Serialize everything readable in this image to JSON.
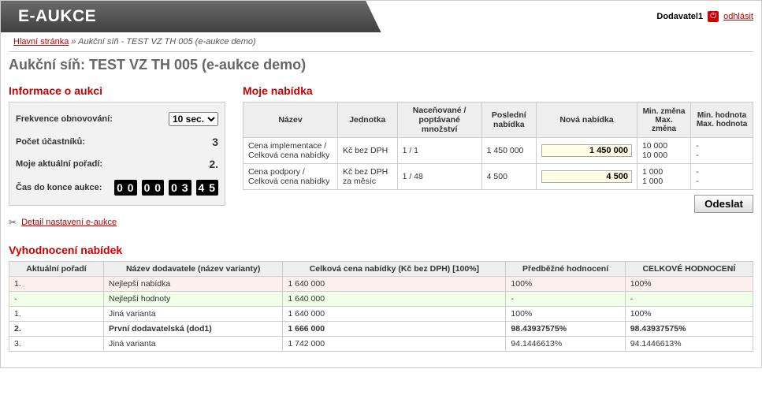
{
  "header": {
    "app_name": "E-AUKCE",
    "user": "Dodavatel1",
    "logout_label": "odhlásit"
  },
  "breadcrumb": {
    "home": "Hlavní stránka",
    "separator": " » ",
    "current": "Aukční síň - TEST VZ TH 005 (e-aukce demo)"
  },
  "page_title": "Aukční síň: TEST VZ TH 005 (e-aukce demo)",
  "info": {
    "title": "Informace o aukci",
    "refresh_label": "Frekvence obnovování:",
    "refresh_value": "10 sec.",
    "participants_label": "Počet účastníků:",
    "participants_value": "3",
    "rank_label": "Moje aktuální pořadí:",
    "rank_value": "2.",
    "countdown_label": "Čas do konce aukce:",
    "countdown_digits": [
      "0 0",
      "0 0",
      "0 3",
      "4 5"
    ],
    "settings_link": "Detail nastavení e-aukce"
  },
  "bids": {
    "title": "Moje nabídka",
    "headers": {
      "name": "Název",
      "unit": "Jednotka",
      "qty": "Naceňované / poptávané množství",
      "last": "Poslední nabídka",
      "new": "Nová nabídka",
      "minchange": "Min. změna Max. změna",
      "minval": "Min. hodnota Max. hodnota"
    },
    "rows": [
      {
        "name": "Cena implementace / Celková cena nabídky",
        "unit": "Kč bez DPH",
        "qty": "1 / 1",
        "last": "1 450 000",
        "new": "1 450 000",
        "minchange1": "10 000",
        "minchange2": "10 000",
        "minval": "-"
      },
      {
        "name": "Cena podpory / Celková cena nabídky",
        "unit": "Kč bez DPH za měsíc",
        "qty": "1 / 48",
        "last": "4 500",
        "new": "4 500",
        "minchange1": "1 000",
        "minchange2": "1 000",
        "minval": "-"
      }
    ],
    "submit": "Odeslat"
  },
  "eval": {
    "title": "Vyhodnocení nabídek",
    "headers": {
      "rank": "Aktuální pořadí",
      "supplier": "Název dodavatele (název varianty)",
      "total": "Celková cena nabídky (Kč bez DPH) [100%]",
      "pre": "Předběžné hodnocení",
      "total_score": "CELKOVÉ HODNOCENÍ"
    },
    "rows": [
      {
        "rank": "1.",
        "supplier": "Nejlepší nabídka",
        "total": "1 640 000",
        "pre": "100%",
        "score": "100%",
        "cls": "best"
      },
      {
        "rank": "-",
        "supplier": "Nejlepší hodnoty",
        "total": "1 640 000",
        "pre": "-",
        "score": "-",
        "cls": "best-val"
      },
      {
        "rank": "1.",
        "supplier": "Jiná varianta",
        "total": "1 640 000",
        "pre": "100%",
        "score": "100%",
        "cls": ""
      },
      {
        "rank": "2.",
        "supplier": "První dodavatelská (dod1)",
        "total": "1 666 000",
        "pre": "98.43937575%",
        "score": "98.43937575%",
        "cls": "me"
      },
      {
        "rank": "3.",
        "supplier": "Jiná varianta",
        "total": "1 742 000",
        "pre": "94.1446613%",
        "score": "94.1446613%",
        "cls": ""
      }
    ]
  }
}
